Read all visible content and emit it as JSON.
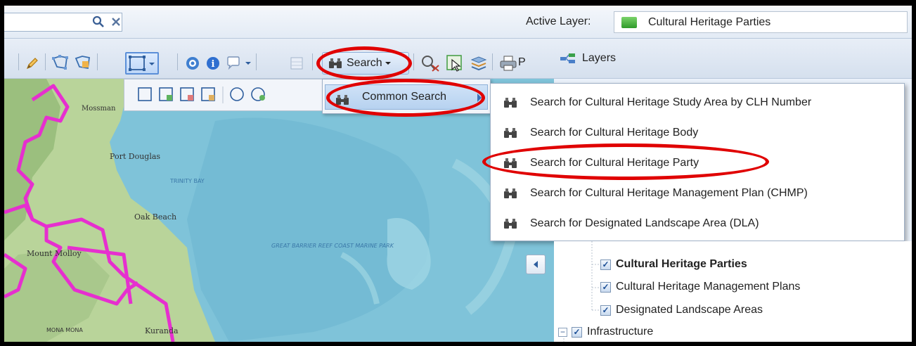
{
  "search_bar": {
    "value": "",
    "search_icon": "magnifier-icon",
    "clear_icon": "close-icon"
  },
  "active_layer": {
    "label": "Active Layer:",
    "value": "Cultural Heritage Parties"
  },
  "toolbar": {
    "search_label": "Search",
    "print_label_partial": "P",
    "icons": [
      "pencil-icon",
      "polygon-select-icon",
      "polygon-edit-icon",
      "rectangle-select-icon",
      "identify-icon",
      "info-icon",
      "comment-icon",
      "table-icon",
      "binoculars-icon",
      "measure-icon",
      "select-icon",
      "layers-stack-icon",
      "print-icon"
    ]
  },
  "layers_panel": {
    "title": "Layers"
  },
  "search_menu": {
    "common_search_label": "Common Search",
    "items": [
      "Search for Cultural Heritage Study Area by CLH Number",
      "Search for Cultural Heritage Body",
      "Search for Cultural Heritage Party",
      "Search for Cultural Heritage Management Plan (CHMP)",
      "Search for Designated Landscape Area (DLA)"
    ]
  },
  "layer_tree": {
    "items": [
      {
        "label": "Cultural Heritage Parties",
        "checked": true,
        "bold": true
      },
      {
        "label": "Cultural Heritage Management Plans",
        "checked": true,
        "bold": false
      },
      {
        "label": "Designated Landscape Areas",
        "checked": true,
        "bold": false
      },
      {
        "label": "Infrastructure",
        "checked": true,
        "bold": false
      }
    ]
  },
  "map_labels": {
    "mossman": "Mossman",
    "port_douglas": "Port Douglas",
    "trinity_bay": "TRINITY BAY",
    "oak_beach": "Oak Beach",
    "marine_park": "GREAT BARRIER REEF COAST MARINE PARK",
    "mount_molloy": "Mount Molloy",
    "kuranda": "Kuranda",
    "mona_mona": "MONA MONA"
  },
  "colors": {
    "highlight": "#e00000",
    "boundary": "#e62fcf",
    "sea": "#7fc3d9",
    "land": "#a7c58a"
  }
}
